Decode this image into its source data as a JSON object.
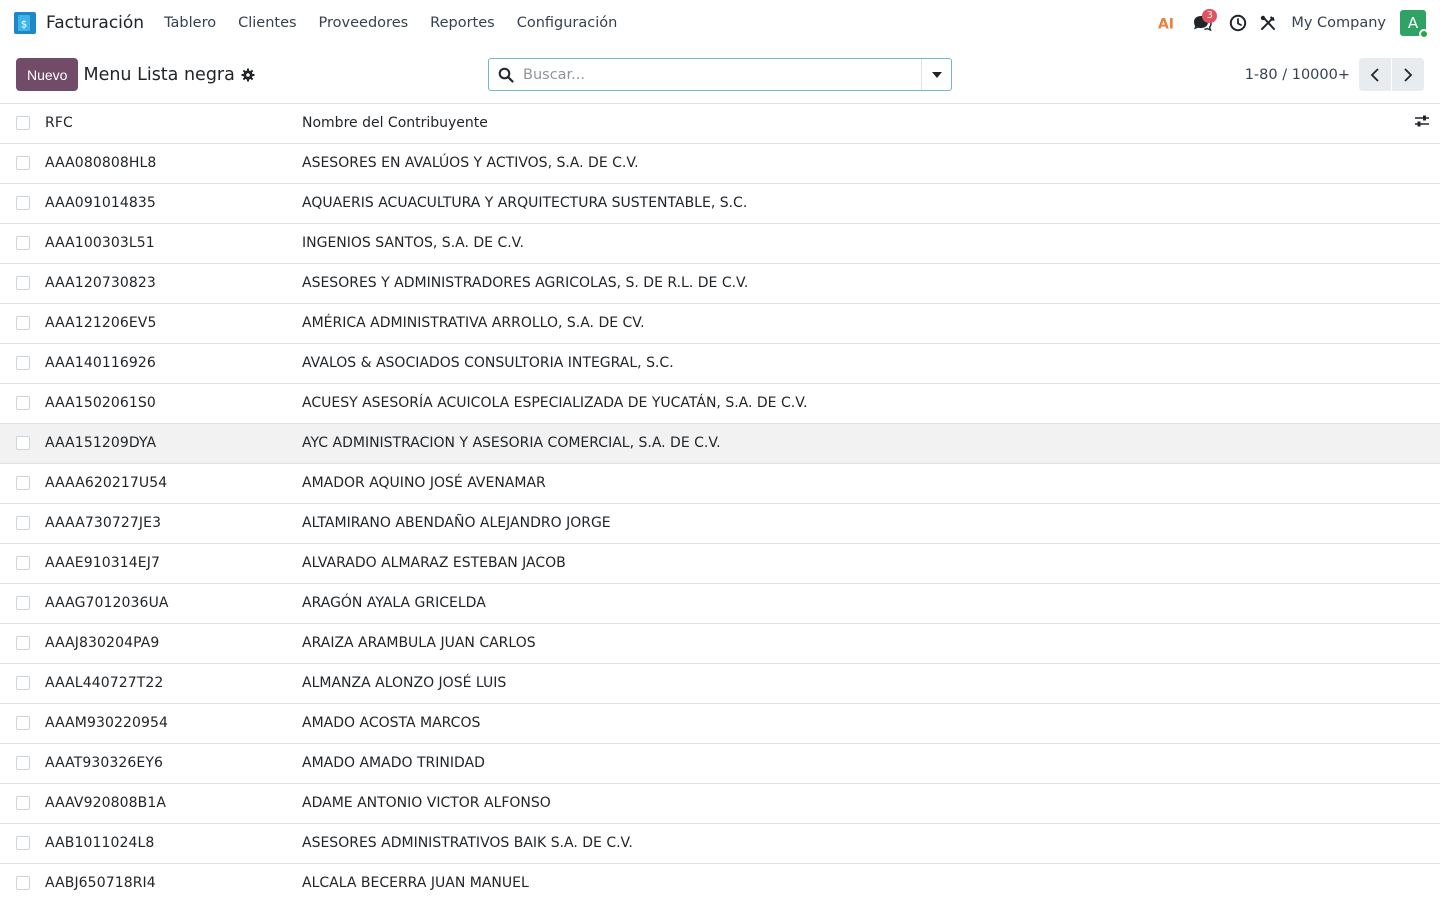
{
  "navbar": {
    "app_name": "Facturación",
    "menu": [
      "Tablero",
      "Clientes",
      "Proveedores",
      "Reportes",
      "Configuración"
    ],
    "ai_label": "AI",
    "ai_color": "#e7823b",
    "messages_badge": "3",
    "company": "My Company",
    "avatar_initial": "A",
    "avatar_color": "#2fa365"
  },
  "control": {
    "new_button": "Nuevo",
    "title": "Menu Lista negra",
    "search_placeholder": "Buscar...",
    "pager": "1-80 / 10000+",
    "accent_color": "#714b67"
  },
  "table": {
    "columns": [
      "RFC",
      "Nombre del Contribuyente"
    ],
    "rows": [
      {
        "rfc": "AAA080808HL8",
        "name": "ASESORES EN AVALÚOS Y ACTIVOS, S.A. DE C.V."
      },
      {
        "rfc": "AAA091014835",
        "name": "AQUAERIS ACUACULTURA Y ARQUITECTURA SUSTENTABLE, S.C."
      },
      {
        "rfc": "AAA100303L51",
        "name": "INGENIOS SANTOS, S.A. DE C.V."
      },
      {
        "rfc": "AAA120730823",
        "name": "ASESORES Y ADMINISTRADORES AGRICOLAS, S. DE R.L. DE C.V."
      },
      {
        "rfc": "AAA121206EV5",
        "name": "AMÉRICA ADMINISTRATIVA ARROLLO, S.A. DE CV."
      },
      {
        "rfc": "AAA140116926",
        "name": "AVALOS & ASOCIADOS CONSULTORIA INTEGRAL, S.C."
      },
      {
        "rfc": "AAA1502061S0",
        "name": "ACUESY ASESORÍA ACUICOLA ESPECIALIZADA DE YUCATÁN, S.A. DE C.V."
      },
      {
        "rfc": "AAA151209DYA",
        "name": "AYC ADMINISTRACION Y ASESORIA COMERCIAL, S.A. DE C.V.",
        "highlighted": true
      },
      {
        "rfc": "AAAA620217U54",
        "name": "AMADOR AQUINO JOSÉ AVENAMAR"
      },
      {
        "rfc": "AAAA730727JE3",
        "name": "ALTAMIRANO ABENDAÑO ALEJANDRO JORGE"
      },
      {
        "rfc": "AAAE910314EJ7",
        "name": "ALVARADO ALMARAZ ESTEBAN JACOB"
      },
      {
        "rfc": "AAAG7012036UA",
        "name": "ARAGÓN AYALA GRICELDA"
      },
      {
        "rfc": "AAAJ830204PA9",
        "name": "ARAIZA ARAMBULA JUAN CARLOS"
      },
      {
        "rfc": "AAAL440727T22",
        "name": "ALMANZA ALONZO JOSÉ LUIS"
      },
      {
        "rfc": "AAAM930220954",
        "name": "AMADO ACOSTA MARCOS"
      },
      {
        "rfc": "AAAT930326EY6",
        "name": "AMADO AMADO TRINIDAD"
      },
      {
        "rfc": "AAAV920808B1A",
        "name": "ADAME ANTONIO VICTOR ALFONSO"
      },
      {
        "rfc": "AAB1011024L8",
        "name": "ASESORES ADMINISTRATIVOS BAIK S.A. DE C.V."
      },
      {
        "rfc": "AABJ650718RI4",
        "name": "ALCALA BECERRA JUAN MANUEL"
      }
    ]
  }
}
